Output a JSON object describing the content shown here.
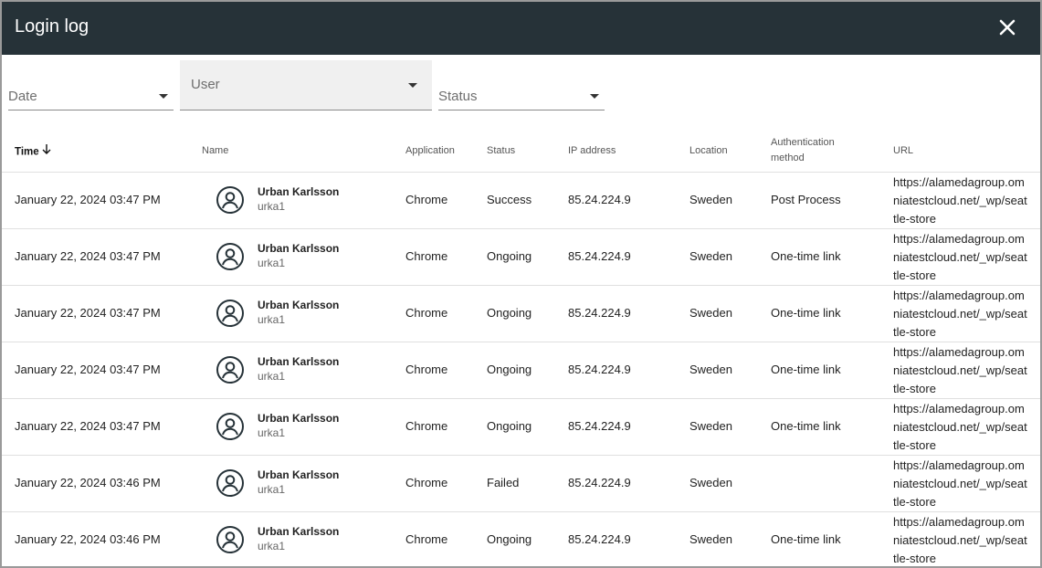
{
  "dialog": {
    "title": "Login log",
    "close_icon": "close-icon"
  },
  "filters": {
    "date_label": "Date",
    "user_label": "User",
    "status_label": "Status"
  },
  "table": {
    "headers": {
      "time": "Time",
      "name": "Name",
      "application": "Application",
      "status": "Status",
      "ip": "IP address",
      "location": "Location",
      "auth_line1": "Authentication",
      "auth_line2": "method",
      "url": "URL"
    },
    "rows": [
      {
        "time": "January 22, 2024 03:47 PM",
        "name": "Urban Karlsson",
        "login": "urka1",
        "application": "Chrome",
        "status": "Success",
        "ip": "85.24.224.9",
        "location": "Sweden",
        "auth": "Post Process",
        "url": "https://alamedagroup.omniatestcloud.net/_wp/seattle-store"
      },
      {
        "time": "January 22, 2024 03:47 PM",
        "name": "Urban Karlsson",
        "login": "urka1",
        "application": "Chrome",
        "status": "Ongoing",
        "ip": "85.24.224.9",
        "location": "Sweden",
        "auth": "One-time link",
        "url": "https://alamedagroup.omniatestcloud.net/_wp/seattle-store"
      },
      {
        "time": "January 22, 2024 03:47 PM",
        "name": "Urban Karlsson",
        "login": "urka1",
        "application": "Chrome",
        "status": "Ongoing",
        "ip": "85.24.224.9",
        "location": "Sweden",
        "auth": "One-time link",
        "url": "https://alamedagroup.omniatestcloud.net/_wp/seattle-store"
      },
      {
        "time": "January 22, 2024 03:47 PM",
        "name": "Urban Karlsson",
        "login": "urka1",
        "application": "Chrome",
        "status": "Ongoing",
        "ip": "85.24.224.9",
        "location": "Sweden",
        "auth": "One-time link",
        "url": "https://alamedagroup.omniatestcloud.net/_wp/seattle-store"
      },
      {
        "time": "January 22, 2024 03:47 PM",
        "name": "Urban Karlsson",
        "login": "urka1",
        "application": "Chrome",
        "status": "Ongoing",
        "ip": "85.24.224.9",
        "location": "Sweden",
        "auth": "One-time link",
        "url": "https://alamedagroup.omniatestcloud.net/_wp/seattle-store"
      },
      {
        "time": "January 22, 2024 03:46 PM",
        "name": "Urban Karlsson",
        "login": "urka1",
        "application": "Chrome",
        "status": "Failed",
        "ip": "85.24.224.9",
        "location": "Sweden",
        "auth": "",
        "url": "https://alamedagroup.omniatestcloud.net/_wp/seattle-store"
      },
      {
        "time": "January 22, 2024 03:46 PM",
        "name": "Urban Karlsson",
        "login": "urka1",
        "application": "Chrome",
        "status": "Ongoing",
        "ip": "85.24.224.9",
        "location": "Sweden",
        "auth": "One-time link",
        "url": "https://alamedagroup.omniatestcloud.net/_wp/seattle-store"
      }
    ]
  },
  "colors": {
    "titlebar": "#263238",
    "user_filter_bg": "#f0f0f0"
  }
}
